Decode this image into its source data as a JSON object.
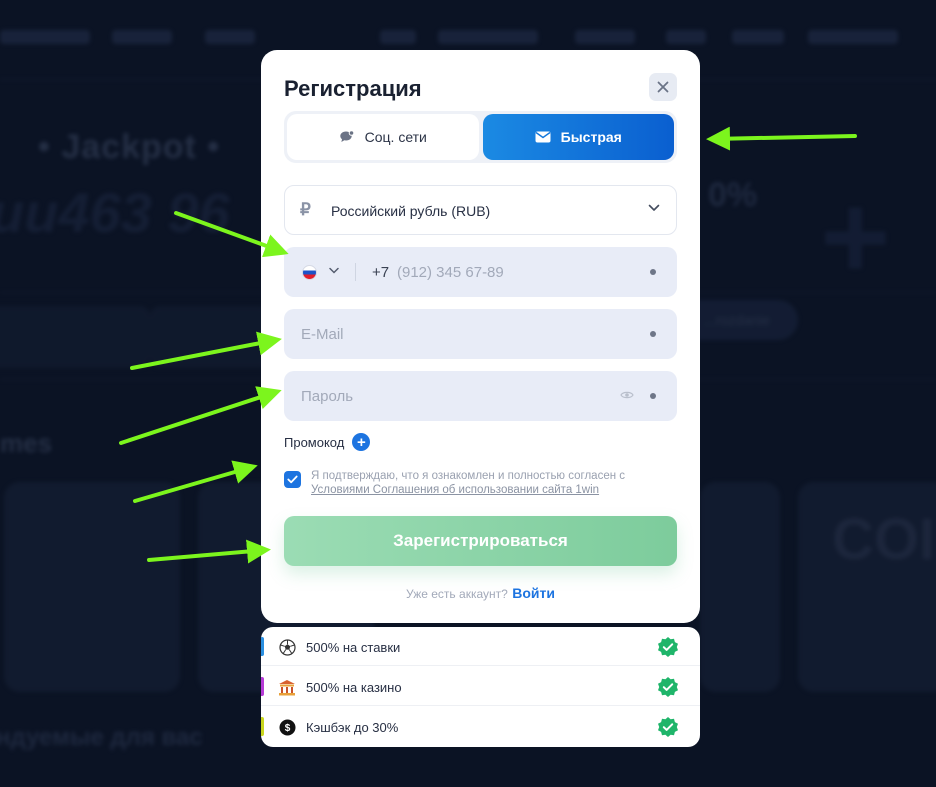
{
  "modal": {
    "title": "Регистрация",
    "tabs": [
      {
        "label": "Соц. сети",
        "active": false
      },
      {
        "label": "Быстрая",
        "active": true
      }
    ],
    "currency": {
      "sign": "₽",
      "label": "Российский рубль (RUB)"
    },
    "phone": {
      "country": "RU",
      "prefix": "+7",
      "placeholder": "(912) 345 67-89"
    },
    "email": {
      "placeholder": "E-Mail"
    },
    "password": {
      "placeholder": "Пароль"
    },
    "promo": {
      "label": "Промокод",
      "plus": "+"
    },
    "agreement": {
      "checked": true,
      "text": "Я подтверждаю, что я ознакомлен и полностью согласен с",
      "link": "Условиями Соглашения об использовании сайта 1win"
    },
    "submit_label": "Зарегистрироваться",
    "login": {
      "question": "Уже есть аккаунт?",
      "link": "Войти"
    }
  },
  "bonuses": [
    {
      "text": "500% на ставки",
      "icon": "soccer-ball-icon",
      "accent": "#2a8fe0"
    },
    {
      "text": "500% на казино",
      "icon": "casino-icon",
      "accent": "#b63bd6"
    },
    {
      "text": "Кэшбэк до 30%",
      "icon": "cashback-icon",
      "accent": "#c9d61e"
    }
  ],
  "colors": {
    "primary_blue": "#1d74e0",
    "submit_green": "#8dd4a8",
    "check_green": "#1fb56a",
    "arrow_green": "#7cf51d"
  }
}
